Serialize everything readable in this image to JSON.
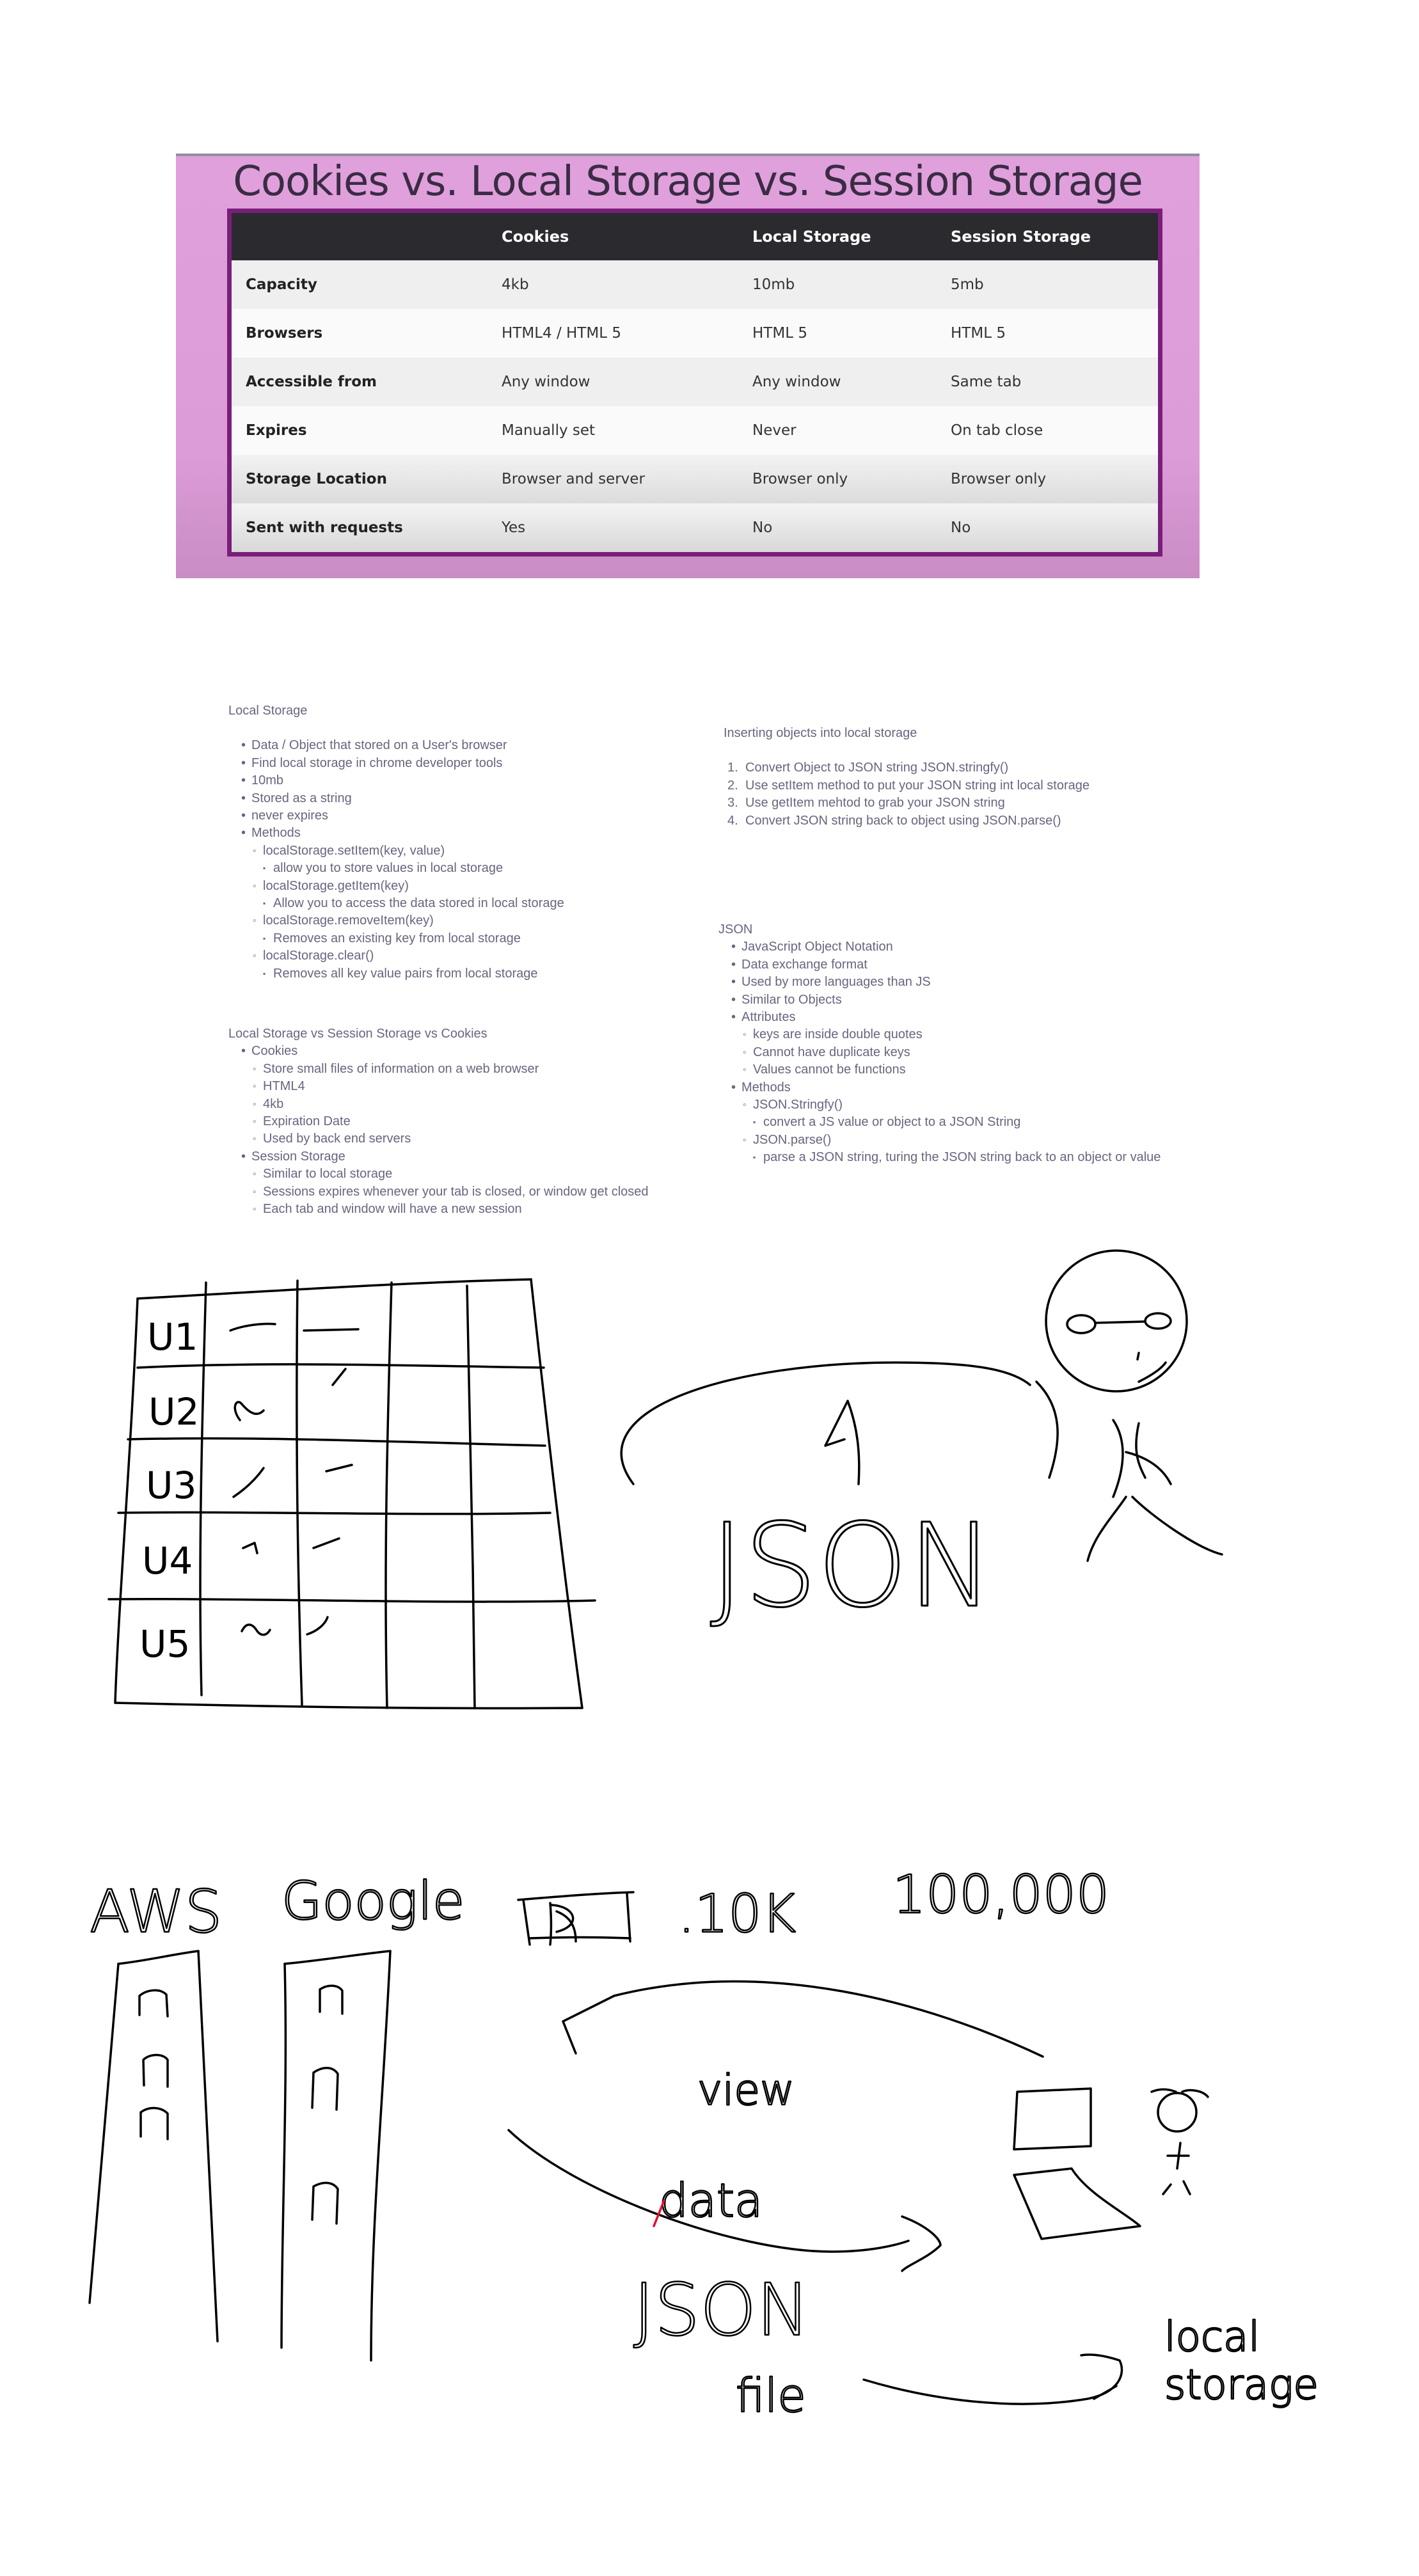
{
  "banner": {
    "title": "Cookies vs. Local Storage vs. Session Storage",
    "headers": [
      "",
      "Cookies",
      "Local Storage",
      "Session Storage"
    ],
    "rows": [
      [
        "Capacity",
        "4kb",
        "10mb",
        "5mb"
      ],
      [
        "Browsers",
        "HTML4 / HTML 5",
        "HTML 5",
        "HTML 5"
      ],
      [
        "Accessible from",
        "Any window",
        "Any window",
        "Same tab"
      ],
      [
        "Expires",
        "Manually set",
        "Never",
        "On tab close"
      ],
      [
        "Storage Location",
        "Browser and server",
        "Browser only",
        "Browser only"
      ],
      [
        "Sent with requests",
        "Yes",
        "No",
        "No"
      ]
    ]
  },
  "local_storage": {
    "heading": "Local Storage",
    "items": [
      "Data / Object that stored on a User's browser",
      "Find local storage in chrome developer tools",
      "10mb",
      "Stored as a string",
      "never expires",
      "Methods"
    ],
    "methods": [
      {
        "name": "localStorage.setItem(key, value)",
        "desc": "allow you to store values in local storage"
      },
      {
        "name": "localStorage.getItem(key)",
        "desc": "Allow you to access the data stored in local storage"
      },
      {
        "name": "localStorage.removeItem(key)",
        "desc": "Removes an existing key from local storage"
      },
      {
        "name": "localStorage.clear()",
        "desc": "Removes all key value pairs from local storage"
      }
    ]
  },
  "inserting": {
    "heading": "Inserting objects into local storage",
    "steps": [
      "Convert Object to JSON string JSON.stringfy()",
      "Use setItem method to put your JSON string int local storage",
      "Use getItem mehtod to grab your JSON string",
      "Convert JSON string back to object using JSON.parse()"
    ]
  },
  "compare": {
    "heading": "Local Storage vs Session Storage vs Cookies",
    "cookies": "Cookies",
    "cookies_items": [
      "Store small files of information on a web browser",
      "HTML4",
      "4kb",
      "Expiration Date",
      "Used by back end servers"
    ],
    "session": "Session Storage",
    "session_items": [
      "Similar to local storage",
      "Sessions expires whenever your tab is closed, or window get closed",
      "Each tab and window will have a new session"
    ]
  },
  "json": {
    "heading": "JSON",
    "items": [
      "JavaScript Object Notation",
      "Data exchange format",
      "Used by more languages than JS",
      "Similar to Objects",
      "Attributes"
    ],
    "attributes": [
      "keys are inside double quotes",
      "Cannot have duplicate keys",
      "Values cannot be functions"
    ],
    "methods_label": "Methods",
    "methods": [
      {
        "name": "JSON.Stringfy()",
        "desc": "convert a JS value or object to a JSON String"
      },
      {
        "name": "JSON.parse()",
        "desc": "parse a JSON string, turing the JSON string back to an object or value"
      }
    ]
  },
  "sketch1": {
    "row_labels": [
      "U1",
      "U2",
      "U3",
      "U4",
      "U5"
    ],
    "word": "JSON"
  },
  "sketch2": {
    "labels": [
      "AWS",
      "Google",
      ".10K",
      "100,000",
      "view",
      "data",
      "JSON",
      "file",
      "local",
      "storage"
    ]
  },
  "colors": {
    "banner_bg": "#e0a0dc",
    "table_border": "#7a1e7a",
    "table_header_bg": "#2b2b2f",
    "note_text": "#666680",
    "ink": "#000000",
    "red_ink": "#e01030"
  }
}
